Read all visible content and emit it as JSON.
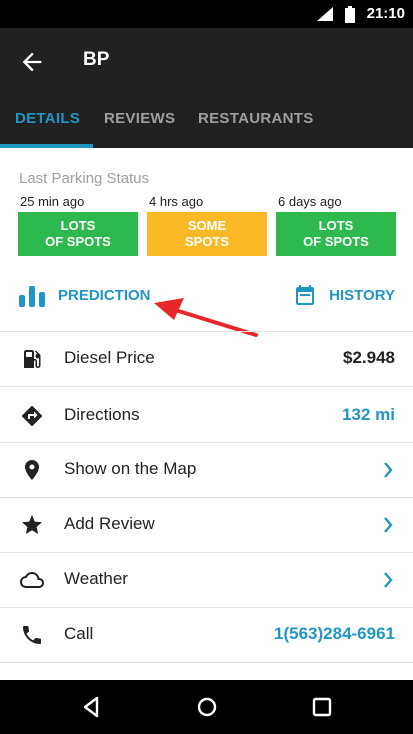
{
  "status_bar": {
    "time": "21:10"
  },
  "app_bar": {
    "title": "BP"
  },
  "tabs": [
    {
      "label": "DETAILS"
    },
    {
      "label": "REVIEWS"
    },
    {
      "label": "RESTAURANTS"
    }
  ],
  "parking": {
    "heading": "Last Parking Status",
    "slots": [
      {
        "ago": "25 min ago",
        "line1": "LOTS",
        "line2": "OF SPOTS",
        "color": "#2db94d"
      },
      {
        "ago": "4 hrs ago",
        "line1": "SOME",
        "line2": "SPOTS",
        "color": "#fbb827"
      },
      {
        "ago": "6 days ago",
        "line1": "LOTS",
        "line2": "OF SPOTS",
        "color": "#2db94d"
      }
    ]
  },
  "actions": {
    "prediction": "PREDICTION",
    "history": "HISTORY"
  },
  "rows": [
    {
      "icon": "gas-pump-icon",
      "label": "Diesel Price",
      "value": "$2.948"
    },
    {
      "icon": "directions-icon",
      "label": "Directions",
      "value": "132 mi"
    },
    {
      "icon": "map-pin-icon",
      "label": "Show on the Map",
      "value": ""
    },
    {
      "icon": "star-icon",
      "label": "Add Review",
      "value": ""
    },
    {
      "icon": "cloud-icon",
      "label": "Weather",
      "value": ""
    },
    {
      "icon": "phone-icon",
      "label": "Call",
      "value": "1(563)284-6961"
    }
  ],
  "colors": {
    "accent": "#2196c3",
    "annotation_arrow": "#e8272a"
  }
}
